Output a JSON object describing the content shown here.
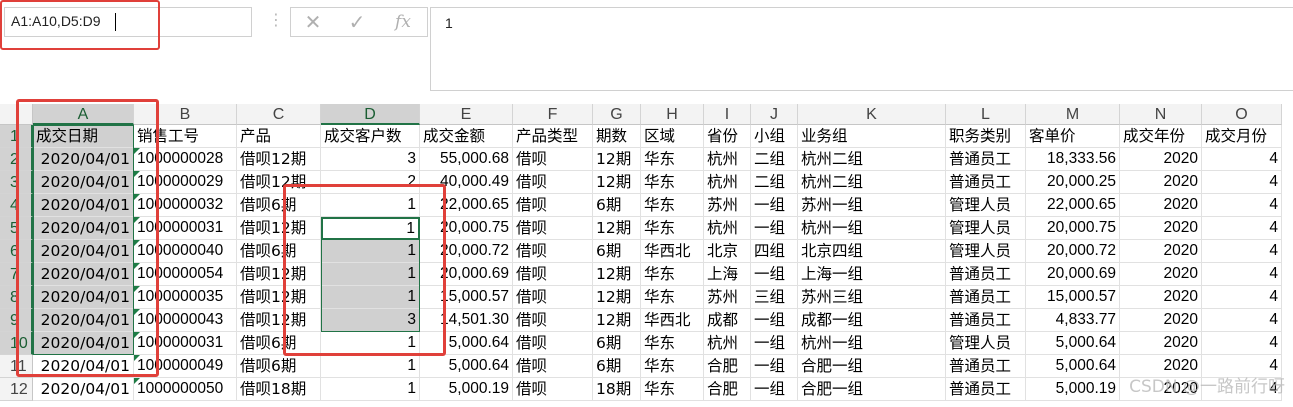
{
  "name_box": {
    "value": "A1:A10,D5:D9"
  },
  "formula_bar": {
    "cancel_icon": "close-icon",
    "confirm_icon": "check-icon",
    "fx_label": "fx",
    "content": "1"
  },
  "columns": [
    "A",
    "B",
    "C",
    "D",
    "E",
    "F",
    "G",
    "H",
    "I",
    "J",
    "K",
    "L",
    "M",
    "N",
    "O"
  ],
  "selected_columns": [
    "A",
    "D"
  ],
  "selected_rows": [
    1,
    2,
    3,
    4,
    5,
    6,
    7,
    8,
    9,
    10
  ],
  "row_numbers": [
    1,
    2,
    3,
    4,
    5,
    6,
    7,
    8,
    9,
    10,
    11,
    12
  ],
  "header_row": [
    "成交日期",
    "销售工号",
    "产品",
    "成交客户数",
    "成交金额",
    "产品类型",
    "期数",
    "区域",
    "省份",
    "小组",
    "业务组",
    "职务类别",
    "客单价",
    "成交年份",
    "成交月份"
  ],
  "rows": [
    [
      "2020/04/01",
      "1000000028",
      "借呗12期",
      "3",
      "55,000.68",
      "借呗",
      "12期",
      "华东",
      "杭州",
      "二组",
      "杭州二组",
      "普通员工",
      "18,333.56",
      "2020",
      "4"
    ],
    [
      "2020/04/01",
      "1000000029",
      "借呗12期",
      "2",
      "40,000.49",
      "借呗",
      "12期",
      "华东",
      "杭州",
      "二组",
      "杭州二组",
      "普通员工",
      "20,000.25",
      "2020",
      "4"
    ],
    [
      "2020/04/01",
      "1000000032",
      "借呗6期",
      "1",
      "22,000.65",
      "借呗",
      "6期",
      "华东",
      "苏州",
      "一组",
      "苏州一组",
      "管理人员",
      "22,000.65",
      "2020",
      "4"
    ],
    [
      "2020/04/01",
      "1000000031",
      "借呗12期",
      "1",
      "20,000.75",
      "借呗",
      "12期",
      "华东",
      "杭州",
      "一组",
      "杭州一组",
      "管理人员",
      "20,000.75",
      "2020",
      "4"
    ],
    [
      "2020/04/01",
      "1000000040",
      "借呗6期",
      "1",
      "20,000.72",
      "借呗",
      "6期",
      "华西北",
      "北京",
      "四组",
      "北京四组",
      "管理人员",
      "20,000.72",
      "2020",
      "4"
    ],
    [
      "2020/04/01",
      "1000000054",
      "借呗12期",
      "1",
      "20,000.69",
      "借呗",
      "12期",
      "华东",
      "上海",
      "一组",
      "上海一组",
      "普通员工",
      "20,000.69",
      "2020",
      "4"
    ],
    [
      "2020/04/01",
      "1000000035",
      "借呗12期",
      "1",
      "15,000.57",
      "借呗",
      "12期",
      "华东",
      "苏州",
      "三组",
      "苏州三组",
      "普通员工",
      "15,000.57",
      "2020",
      "4"
    ],
    [
      "2020/04/01",
      "1000000043",
      "借呗12期",
      "3",
      "14,501.30",
      "借呗",
      "12期",
      "华西北",
      "成都",
      "一组",
      "成都一组",
      "普通员工",
      "4,833.77",
      "2020",
      "4"
    ],
    [
      "2020/04/01",
      "1000000031",
      "借呗6期",
      "1",
      "5,000.64",
      "借呗",
      "6期",
      "华东",
      "杭州",
      "一组",
      "杭州一组",
      "管理人员",
      "5,000.64",
      "2020",
      "4"
    ],
    [
      "2020/04/01",
      "1000000049",
      "借呗6期",
      "1",
      "5,000.64",
      "借呗",
      "6期",
      "华东",
      "合肥",
      "一组",
      "合肥一组",
      "普通员工",
      "5,000.64",
      "2020",
      "4"
    ],
    [
      "2020/04/01",
      "1000000050",
      "借呗18期",
      "1",
      "5,000.19",
      "借呗",
      "18期",
      "华东",
      "合肥",
      "一组",
      "合肥一组",
      "普通员工",
      "5,000.19",
      "2020",
      "4"
    ]
  ],
  "watermark": "CSDN @一路前行呀"
}
